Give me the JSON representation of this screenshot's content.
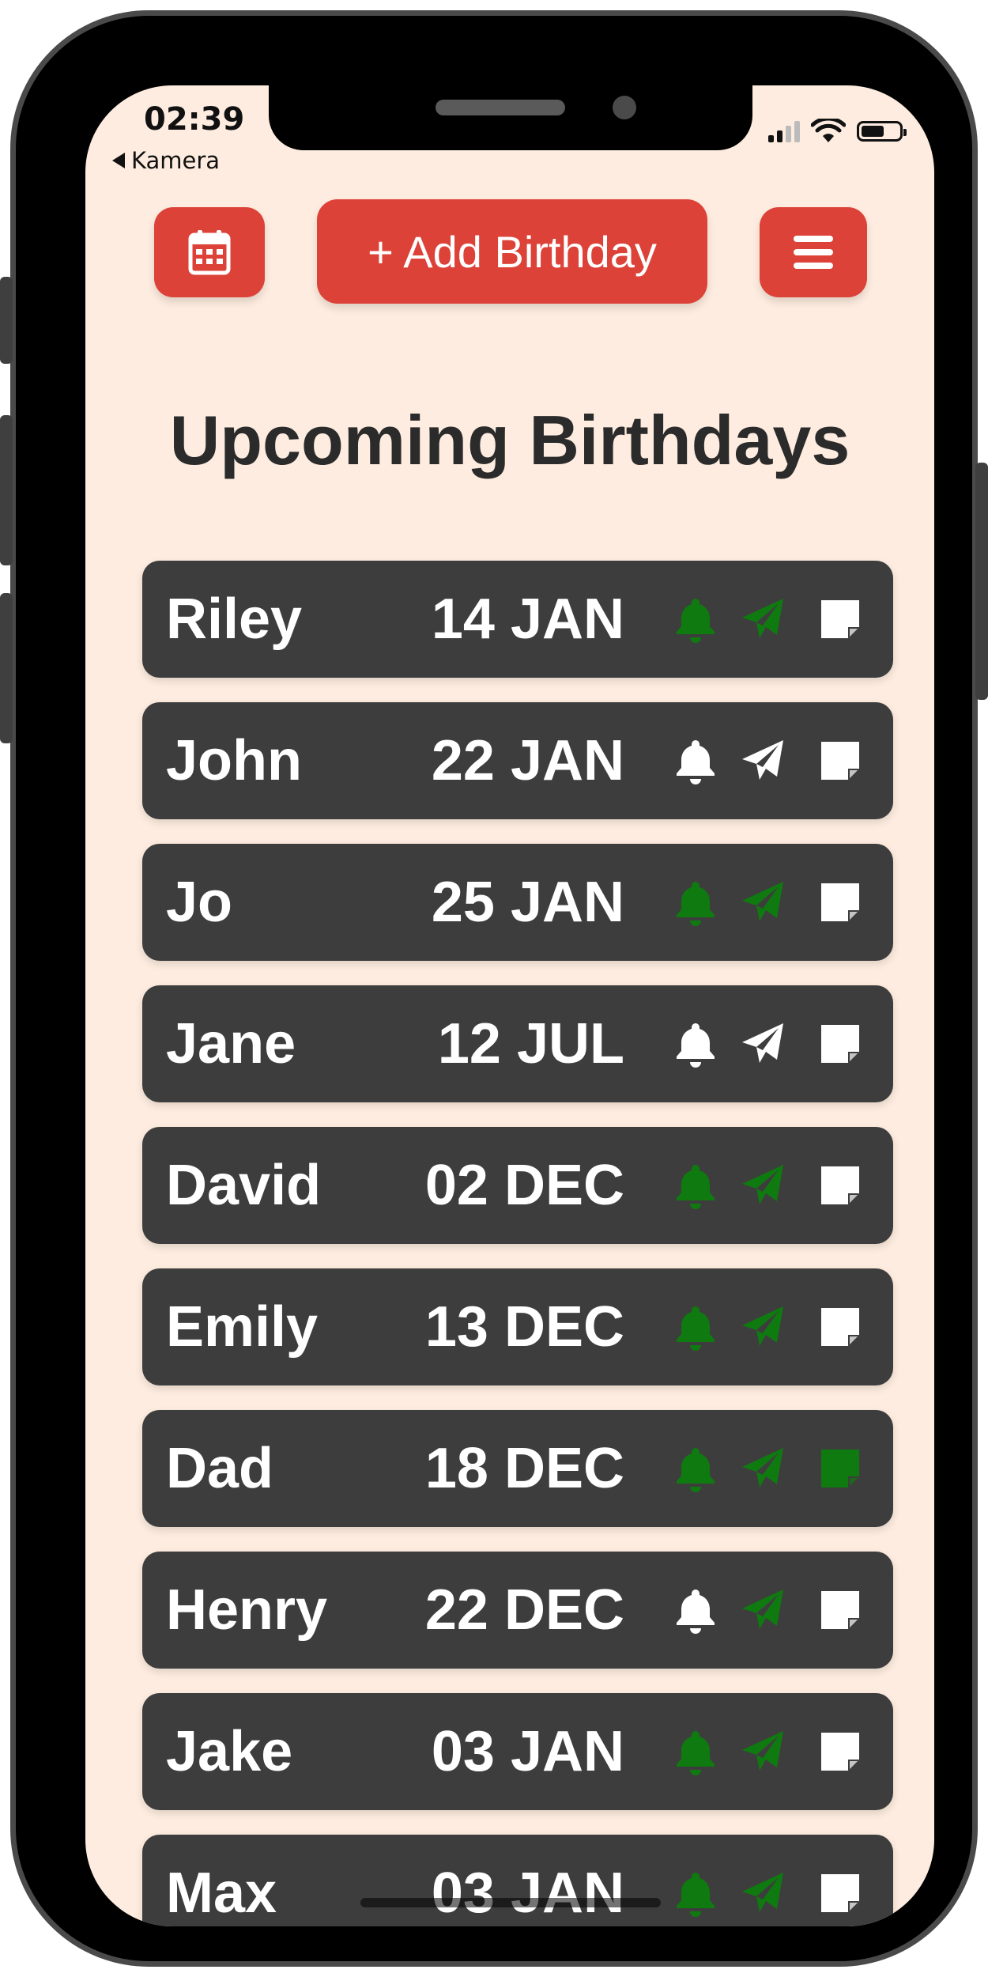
{
  "status_bar": {
    "time": "02:39",
    "back_label": "Kamera"
  },
  "toolbar": {
    "calendar_icon": "calendar-icon",
    "add_label": "+ Add Birthday",
    "menu_icon": "menu-icon"
  },
  "page": {
    "title": "Upcoming Birthdays"
  },
  "colors": {
    "accent": "#dc4238",
    "active_icon": "#0f7a0f",
    "inactive_icon": "#ffffff",
    "row_bg": "#3d3d3d",
    "page_bg": "#fdecdf"
  },
  "birthdays": [
    {
      "name": "Riley",
      "date": "14 JAN",
      "reminder": true,
      "message": true,
      "note": false
    },
    {
      "name": "John",
      "date": "22 JAN",
      "reminder": false,
      "message": false,
      "note": false
    },
    {
      "name": "Jo",
      "date": "25 JAN",
      "reminder": true,
      "message": true,
      "note": false
    },
    {
      "name": "Jane",
      "date": "12 JUL",
      "reminder": false,
      "message": false,
      "note": false
    },
    {
      "name": "David",
      "date": "02 DEC",
      "reminder": true,
      "message": true,
      "note": false
    },
    {
      "name": "Emily",
      "date": "13 DEC",
      "reminder": true,
      "message": true,
      "note": false
    },
    {
      "name": "Dad",
      "date": "18 DEC",
      "reminder": true,
      "message": true,
      "note": true
    },
    {
      "name": "Henry",
      "date": "22 DEC",
      "reminder": false,
      "message": true,
      "note": false
    },
    {
      "name": "Jake",
      "date": "03 JAN",
      "reminder": true,
      "message": true,
      "note": false
    },
    {
      "name": "Max",
      "date": "03 JAN",
      "reminder": true,
      "message": true,
      "note": false
    }
  ]
}
